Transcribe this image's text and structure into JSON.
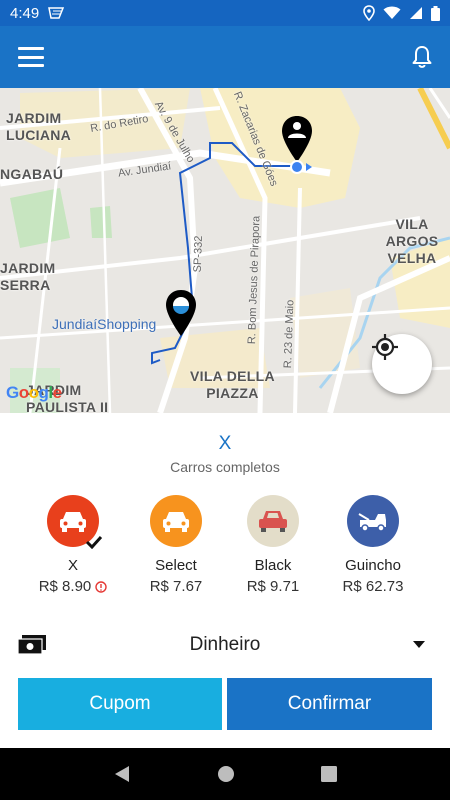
{
  "status_bar": {
    "time": "4:49"
  },
  "map": {
    "labels": {
      "jardim_luciana": "JARDIM\nLUCIANA",
      "ngabau": "NGABAÚ",
      "jardim_serra": "JARDIM\nSERRA",
      "vila_argos": "VILA ARGOS\nVELHA",
      "vila_piazza": "VILA DELLA\nPIAZZA",
      "jardim_paulista": "JARDIM\nPAULISTA II"
    },
    "streets": {
      "retiro": "R. do Retiro",
      "nove_julho": "Av. 9 de Julho",
      "jundiai": "Av. Jundiaí",
      "zacarias": "R. Zacarias de Góes",
      "sp332": "SP-332",
      "bom_jesus": "R. Bom Jesus de Pirapora",
      "vinte_tres_maio": "R. 23 de Maio"
    },
    "poi": "JundiaíShopping",
    "google_logo": "Google"
  },
  "panel": {
    "category_title": "X",
    "category_subtitle": "Carros completos",
    "options": [
      {
        "name": "X",
        "price": "R$ 8.90",
        "color": "#e8401c",
        "selected": true
      },
      {
        "name": "Select",
        "price": "R$ 7.67",
        "color": "#f7931e"
      },
      {
        "name": "Black",
        "price": "R$ 9.71",
        "color": "#e3ddc9"
      },
      {
        "name": "Guincho",
        "price": "R$ 62.73",
        "color": "#3d5fa9"
      }
    ],
    "payment_method": "Dinheiro",
    "coupon_label": "Cupom",
    "confirm_label": "Confirmar"
  },
  "colors": {
    "primary": "#1a73c6",
    "status_bar": "#1565c0",
    "accent": "#18aee0"
  },
  "icons": [
    "menu-icon",
    "bell-icon",
    "location-pin-icon",
    "my-location-icon",
    "car-icon",
    "tow-truck-icon",
    "cash-icon",
    "dropdown-arrow-icon",
    "check-icon",
    "info-icon",
    "back-icon",
    "home-icon",
    "recents-icon"
  ]
}
